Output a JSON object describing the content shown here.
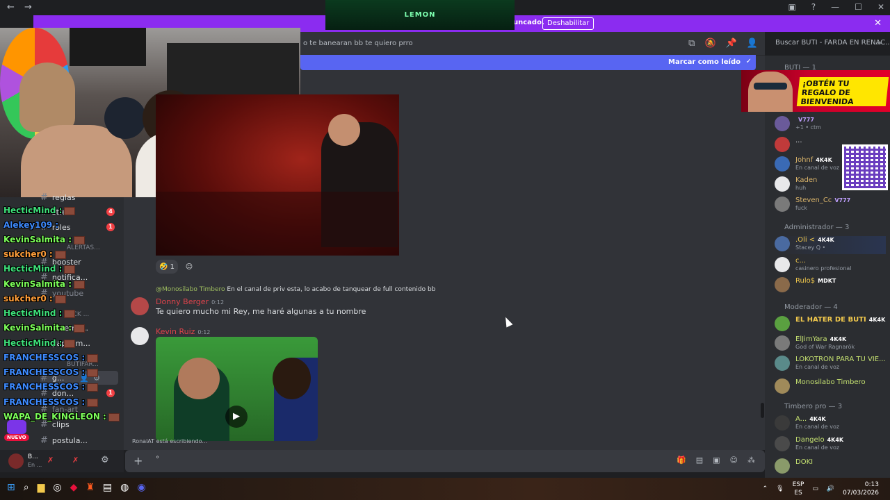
{
  "window": {
    "back": "←",
    "forward": "→",
    "controls": [
      "▣",
      "?",
      "—",
      "☐",
      "✕"
    ]
  },
  "lemon_overlay": "LEMON",
  "banner": {
    "text": "uncado.",
    "button": "Deshabilitar",
    "close": "✕"
  },
  "header": {
    "topic": "o te banearan bb te quiero prro",
    "search_placeholder": "Buscar BUTI - FARDA EN RENAC...",
    "icons": [
      "threads-icon",
      "mute-icon",
      "pin-icon",
      "members-icon"
    ]
  },
  "mark_read": "Marcar como leído",
  "overlay_chat": [
    {
      "user": "HecticMind :",
      "color": "#3ee07a"
    },
    {
      "user": "Alekey109 :",
      "color": "#3e8bff"
    },
    {
      "user": "KevinSalmita :",
      "color": "#7dff5a"
    },
    {
      "user": "sukcher0 :",
      "color": "#ff9e3a"
    },
    {
      "user": "HecticMind :",
      "color": "#3ee07a"
    },
    {
      "user": "KevinSalmita :",
      "color": "#7dff5a"
    },
    {
      "user": "sukcher0 :",
      "color": "#ff9e3a"
    },
    {
      "user": "HecticMind :",
      "color": "#3ee07a"
    },
    {
      "user": "KevinSalmita :",
      "color": "#7dff5a"
    },
    {
      "user": "HecticMind :",
      "color": "#3ee07a"
    },
    {
      "user": "FRANCHESSCOS :",
      "color": "#3e8bff"
    },
    {
      "user": "FRANCHESSCOS :",
      "color": "#3e8bff"
    },
    {
      "user": "FRANCHESSCOS :",
      "color": "#3e8bff"
    },
    {
      "user": "FRANCHESSCOS :",
      "color": "#3e8bff"
    },
    {
      "user": "WAPA_DE_KINGLEON :",
      "color": "#7dff5a"
    }
  ],
  "channels": [
    {
      "name": "reglas",
      "badge": ""
    },
    {
      "name": "stre...",
      "badge": "4"
    },
    {
      "name": "roles",
      "badge": "1"
    },
    {
      "name": "booster",
      "badge": ""
    },
    {
      "name": "notifica...",
      "badge": ""
    },
    {
      "name": "youtube",
      "badge": ""
    },
    {
      "name": "ar-lemo...",
      "badge": ""
    },
    {
      "name": "yapeam...",
      "badge": ""
    },
    {
      "name": "g...",
      "badge": ""
    },
    {
      "name": "don...",
      "badge": "1"
    },
    {
      "name": "fan-art",
      "badge": ""
    },
    {
      "name": "clips",
      "badge": ""
    },
    {
      "name": "postula...",
      "badge": ""
    }
  ],
  "categories": [
    "ALERTAS...",
    "KICK ...",
    "BUTIFAR..."
  ],
  "nuevo_badge": "NUEVO",
  "messages": {
    "reaction_count": "1",
    "reply_ref_user": "@Monosilabo Timbero",
    "reply_ref_text": "En el canal de priv esta, lo acabo de tanquear de full contenido bb",
    "msg1_author": "Donny Berger",
    "msg1_time": "0:12",
    "msg1_text": "Te quiero mucho mi Rey, me haré algunas a tu nombre",
    "msg2_author": "Kevin Ruiz",
    "msg2_time": "0:12"
  },
  "typing": "RonalAT está escribiendo...",
  "input": {
    "value": "°",
    "plus": "+"
  },
  "user_panel": {
    "name": "B...",
    "status": "En ..."
  },
  "ad": {
    "text": "¡OBTÉN TU REGALO DE BIENVENIDA"
  },
  "members": {
    "groups": [
      "BUTI — 1",
      "Administrador — 3",
      "Moderador — 4",
      "Timbero pro — 3"
    ],
    "list": [
      {
        "name": "",
        "tag": "V777",
        "sub": "+1 • ctm",
        "color": "#dbdee1"
      },
      {
        "name": "...",
        "tag": "",
        "sub": "",
        "color": "#dbdee1"
      },
      {
        "name": "Johnf",
        "tag": "4K4K",
        "sub": "En canal de voz",
        "color": "#d9b36a"
      },
      {
        "name": "Kaden",
        "tag": "",
        "sub": "huh",
        "color": "#d9b36a"
      },
      {
        "name": "Steven_Cc",
        "tag": "V777",
        "sub": "fuck",
        "color": "#d9b36a"
      },
      {
        "name": ".Oli <",
        "tag": "4K4K",
        "sub": "Stacey Q •",
        "color": "#f2c94c"
      },
      {
        "name": "c...",
        "tag": "",
        "sub": "casinero profesional",
        "color": "#f2c94c"
      },
      {
        "name": "Rulo$",
        "tag": "MDKT",
        "sub": "",
        "color": "#f2c94c"
      },
      {
        "name": "EL HATER DE BUTI",
        "tag": "4K4K",
        "sub": "",
        "color": "#f2c94c"
      },
      {
        "name": "ElJimYara",
        "tag": "4K4K",
        "sub": "God of War Ragnarök",
        "color": "#c4e070"
      },
      {
        "name": "LOKOTRON PARA TU VIE...",
        "tag": "",
        "sub": "En canal de voz",
        "color": "#c4e070"
      },
      {
        "name": "Monosilabo Timbero",
        "tag": "",
        "sub": "",
        "color": "#c4e070"
      },
      {
        "name": "A...",
        "tag": "4K4K",
        "sub": "En canal de voz",
        "color": "#c4e070"
      },
      {
        "name": "Dangelo",
        "tag": "4K4K",
        "sub": "En canal de voz",
        "color": "#c4e070"
      },
      {
        "name": "DOKI",
        "tag": "",
        "sub": "",
        "color": "#c4e070"
      }
    ]
  },
  "taskbar": {
    "lang1": "ESP",
    "lang2": "ES",
    "time": "0:13",
    "date": "07/03/2026"
  }
}
